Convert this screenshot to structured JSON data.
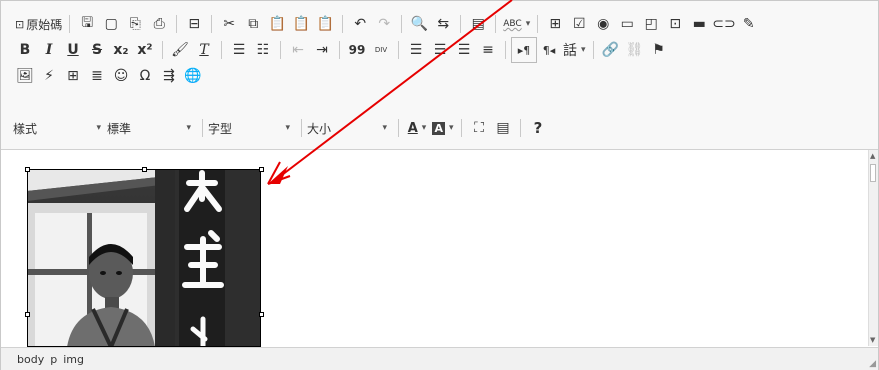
{
  "toolbar": {
    "row1": {
      "source_label": "原始碼",
      "spellcheck_label": "ABC"
    },
    "row2": {
      "bold": "B",
      "italic": "I",
      "underline": "U",
      "strike": "S",
      "subscript": "x₂",
      "superscript": "x²",
      "blockquote": "99",
      "div_label": "DIV",
      "language_label": "話"
    },
    "row4": {
      "styles_label": "樣式",
      "format_label": "標準",
      "font_label": "字型",
      "size_label": "大小",
      "text_color_label": "A",
      "bg_color_label": "A",
      "help_label": "?"
    }
  },
  "statusbar": {
    "path": [
      "body",
      "p",
      "img"
    ]
  },
  "colors": {
    "arrow": "#e60000",
    "toolbar_bg": "#f8f8f8",
    "border": "#c9c9c9"
  }
}
